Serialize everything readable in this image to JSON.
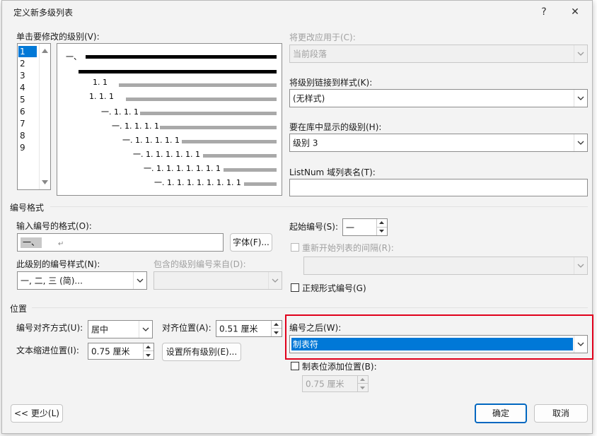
{
  "title": "定义新多级列表",
  "title_buttons": {
    "help": "?",
    "close": "✕"
  },
  "left_labels": {
    "click_level": "单击要修改的级别(V):",
    "number_format_section": "编号格式",
    "enter_format": "输入编号的格式(O):",
    "number_style": "此级别的编号样式(N):",
    "include_from": "包含的级别编号来自(D):",
    "position_section": "位置",
    "alignment": "编号对齐方式(U):",
    "align_at": "对齐位置(A):",
    "indent_at": "文本缩进位置(I):"
  },
  "levels": [
    "1",
    "2",
    "3",
    "4",
    "5",
    "6",
    "7",
    "8",
    "9"
  ],
  "preview": {
    "lines": [
      "一、",
      "1. 1",
      "1. 1. 1",
      "一. 1. 1. 1",
      "一. 1. 1. 1. 1",
      "一. 1. 1. 1. 1. 1",
      "一. 1. 1. 1. 1. 1. 1",
      "一. 1. 1. 1. 1. 1. 1. 1",
      "一. 1. 1. 1. 1. 1. 1. 1. 1"
    ]
  },
  "inputs": {
    "format_value": "一、",
    "format_suffix": "↵",
    "number_style_value": "一, 二, 三 (简)...",
    "alignment_value": "居中",
    "align_at_value": "0.51 厘米",
    "indent_at_value": "0.75 厘米",
    "start_at_value": "一",
    "apply_to_value": "当前段落",
    "link_style_value": "(无样式)",
    "gallery_level_value": "级别 3",
    "listnum_value": "",
    "follow_value": "制表符",
    "tab_stop_value": "0.75 厘米"
  },
  "buttons": {
    "font": "字体(F)...",
    "set_all_levels": "设置所有级别(E)...",
    "less": "<< 更少(L)",
    "ok": "确定",
    "cancel": "取消"
  },
  "right_labels": {
    "apply_to": "将更改应用于(C):",
    "link_style": "将级别链接到样式(K):",
    "gallery_level": "要在库中显示的级别(H):",
    "listnum": "ListNum 域列表名(T):",
    "start_at": "起始编号(S):",
    "restart_after": "重新开始列表的间隔(R):",
    "legal_style": "正规形式编号(G)",
    "follow_with": "编号之后(W):",
    "add_tab_stop": "制表位添加位置(B):"
  },
  "colors": {
    "accent": "#0067c0",
    "selection": "#0078d7",
    "highlight_border": "#e0001b"
  }
}
